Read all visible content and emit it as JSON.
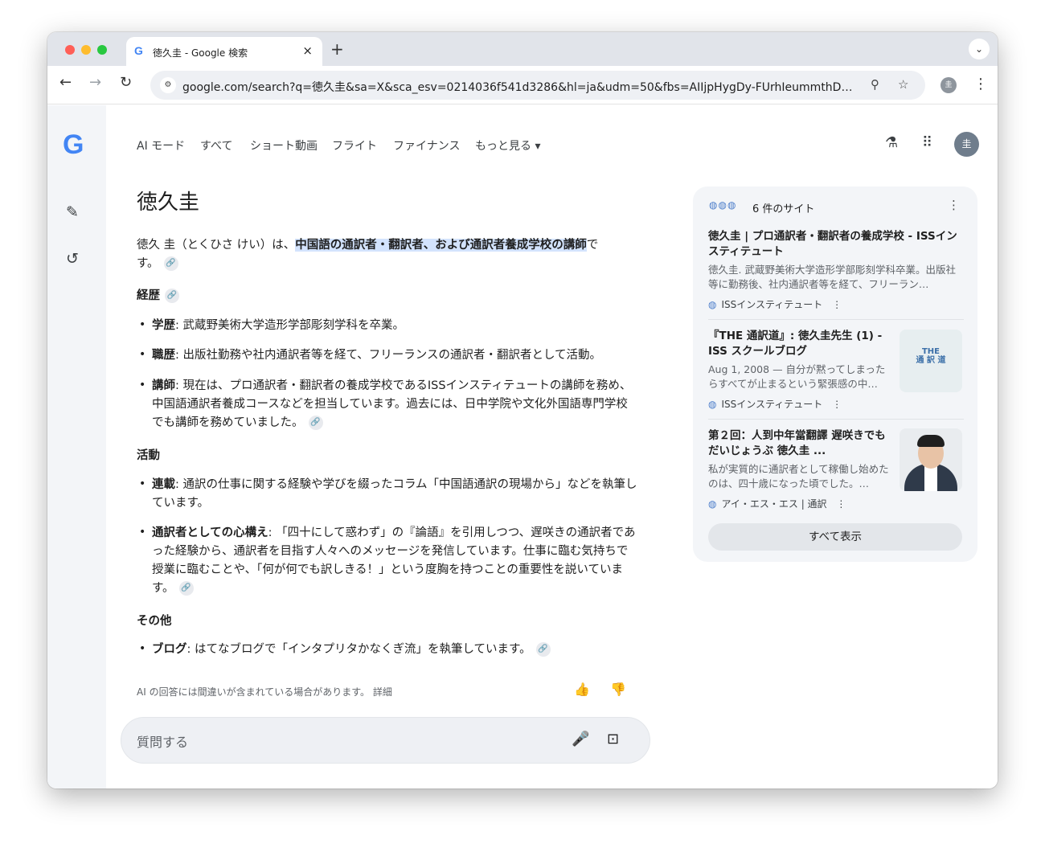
{
  "browser": {
    "tab_title": "徳久圭 - Google 検索",
    "tab_favicon": "G",
    "tab_close": "×",
    "new_tab": "+",
    "tab_search": "⌄",
    "url": "google.com/search?q=徳久圭&sa=X&sca_esv=0214036f541d3286&hl=ja&udm=50&fbs=AIIjpHygDy-FUrhIeummthDfrE...",
    "profile_initial": "圭"
  },
  "nav": {
    "items": [
      "AI モード",
      "すべて",
      "ショート動画",
      "フライト",
      "ファイナンス",
      "もっと見る ▾"
    ],
    "avatar_initial": "圭"
  },
  "answer": {
    "title": "徳久圭",
    "intro_pre": "徳久 圭（とくひさ けい）は、",
    "intro_highlight": "中国語の通訳者・翻訳者、および通訳者養成学校の講師",
    "intro_post": "で",
    "intro_line2": "す。",
    "sections": [
      {
        "heading": "経歴",
        "items": [
          {
            "label": "学歴",
            "text": ": 武蔵野美術大学造形学部彫刻学科を卒業。"
          },
          {
            "label": "職歴",
            "text": ": 出版社勤務や社内通訳者等を経て、フリーランスの通訳者・翻訳者として活動。"
          },
          {
            "label": "講師",
            "text": ": 現在は、プロ通訳者・翻訳者の養成学校であるISSインスティテュートの講師を務め、中国語通訳者養成コースなどを担当しています。過去には、日中学院や文化外国語専門学校でも講師を務めていました。"
          }
        ]
      },
      {
        "heading": "活動",
        "items": [
          {
            "label": "連載",
            "text": ": 通訳の仕事に関する経験や学びを綴ったコラム「中国語通訳の現場から」などを執筆しています。"
          },
          {
            "label": "通訳者としての心構え",
            "text": ": 「四十にして惑わず」の『論語』を引用しつつ、遅咲きの通訳者であった経験から、通訳者を目指す人々へのメッセージを発信しています。仕事に臨む気持ちで授業に臨むことや、「何が何でも訳しきる！」という度胸を持つことの重要性を説いています。"
          }
        ]
      },
      {
        "heading": "その他",
        "items": [
          {
            "label": "ブログ",
            "text": ": はてなブログで「インタプリタかなくぎ流」を執筆しています。"
          }
        ]
      }
    ],
    "disclaimer": "AI の回答には間違いが含まれている場合があります。 詳細",
    "ask_placeholder": "質問する"
  },
  "sources": {
    "count_label": "6 件のサイト",
    "items": [
      {
        "title": "徳久圭 | プロ通訳者・翻訳者の養成学校 - ISSインスティテュート",
        "snippet": "徳久圭. 武蔵野美術大学造形学部彫刻学科卒業。出版社等に勤務後、社内通訳者等を経て、フリーラン…",
        "site": "ISSインスティテュート"
      },
      {
        "title": "『THE 通訳道』: 徳久圭先生 (1) - ISS スクールブログ",
        "snippet": "Aug 1, 2008 — 自分が黙ってしまったらすべてが止まるという緊張感の中…",
        "site": "ISSインスティテュート",
        "thumb_text": "THE\n通 訳 道"
      },
      {
        "title": "第２回：人到中年當翻譯 遅咲きでもだいじょうぶ 徳久圭 ...",
        "snippet": "私が実質的に通訳者として稼働し始めたのは、四十歳になった頃でした。…",
        "site": "アイ・エス・エス | 通訳"
      }
    ],
    "show_all": "すべて表示"
  },
  "icons": {
    "back": "arrow-left-icon",
    "forward": "arrow-right-icon",
    "reload": "reload-icon",
    "zoom": "magnifier-icon",
    "bookmark": "star-icon",
    "labs": "flask-icon",
    "apps": "grid-icon",
    "new_chat": "edit-icon",
    "history": "history-icon",
    "link": "link-icon",
    "mic": "mic-icon",
    "lens": "camera-search-icon",
    "thumbs_up": "thumbs-up-icon",
    "thumbs_down": "thumbs-down-icon"
  },
  "colors": {
    "highlight": "#d3e3fd",
    "google_blue": "#4285f4",
    "google_red": "#ea4335",
    "google_yellow": "#fbbc05",
    "google_green": "#34a853"
  }
}
